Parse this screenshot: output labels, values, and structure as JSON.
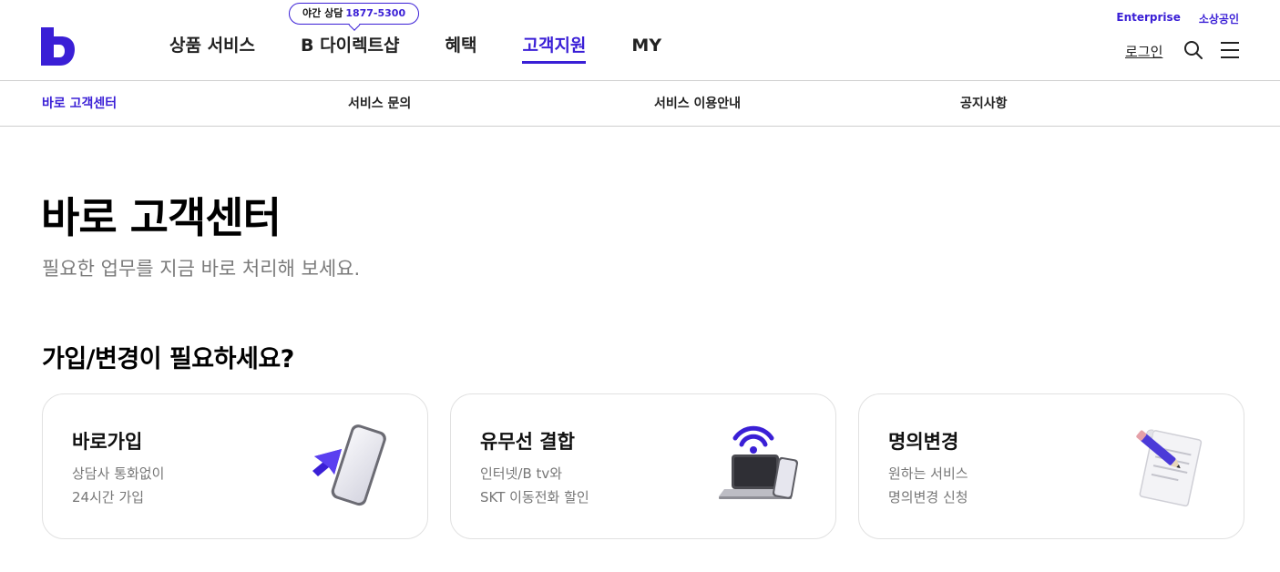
{
  "header": {
    "logo_alt": "B",
    "night_consult": {
      "label": "야간 상담",
      "number": "1877-5300"
    },
    "gnb": [
      "상품 서비스",
      "B 다이렉트샵",
      "혜택",
      "고객지원",
      "MY"
    ],
    "gnb_active_index": 3,
    "util_links": [
      "Enterprise",
      "소상공인"
    ],
    "login": "로그인",
    "icons": {
      "search": "search-icon",
      "menu": "hamburger-menu-icon"
    }
  },
  "subnav": {
    "items": [
      "바로 고객센터",
      "서비스 문의",
      "서비스 이용안내",
      "공지사항"
    ],
    "active_index": 0
  },
  "main": {
    "title": "바로 고객센터",
    "description": "필요한 업무를 지금 바로 처리해 보세요.",
    "section_title": "가입/변경이 필요하세요?",
    "cards": [
      {
        "title": "바로가입",
        "desc1": "상담사 통화없이",
        "desc2": "24시간 가입",
        "icon": "smartphone-cursor-icon"
      },
      {
        "title": "유무선 결합",
        "desc1": "인터넷/B tv와",
        "desc2": "SKT 이동전화 할인",
        "icon": "laptop-wifi-phone-icon"
      },
      {
        "title": "명의변경",
        "desc1": "원하는 서비스",
        "desc2": "명의변경 신청",
        "icon": "document-pencil-icon"
      }
    ]
  },
  "colors": {
    "accent": "#3a1fd6",
    "text": "#111111",
    "muted": "#777777",
    "border": "#e1e1e1"
  }
}
